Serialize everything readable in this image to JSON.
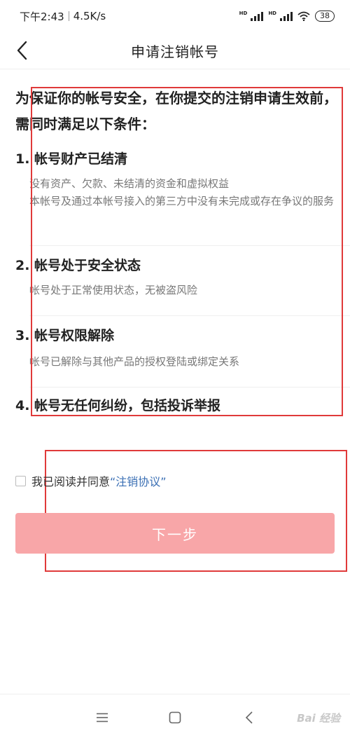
{
  "status_bar": {
    "time": "下午2:43",
    "speed": "4.5K/s",
    "hd_label": "HD",
    "battery": "38"
  },
  "header": {
    "title": "申请注销帐号"
  },
  "intro": "为保证你的帐号安全，在你提交的注销申请生效前，需同时满足以下条件：",
  "conditions": [
    {
      "title": "1. 帐号财产已结清",
      "desc": "没有资产、欠款、未结清的资金和虚拟权益\n本帐号及通过本帐号接入的第三方中没有未完成或存在争议的服务"
    },
    {
      "title": "2. 帐号处于安全状态",
      "desc": "帐号处于正常使用状态，无被盗风险"
    },
    {
      "title": "3. 帐号权限解除",
      "desc": "帐号已解除与其他产品的授权登陆或绑定关系"
    },
    {
      "title": "4. 帐号无任何纠纷，包括投诉举报",
      "desc": ""
    }
  ],
  "agreement": {
    "prefix": "我已阅读并同意",
    "link": "“注销协议”",
    "checked": false
  },
  "next_button": {
    "label": "下一步",
    "enabled": false
  },
  "watermark": "Bai 经验",
  "colors": {
    "accent_disabled": "#f8a6a8",
    "link": "#3a6fb4",
    "annotation": "#e03a3a"
  }
}
